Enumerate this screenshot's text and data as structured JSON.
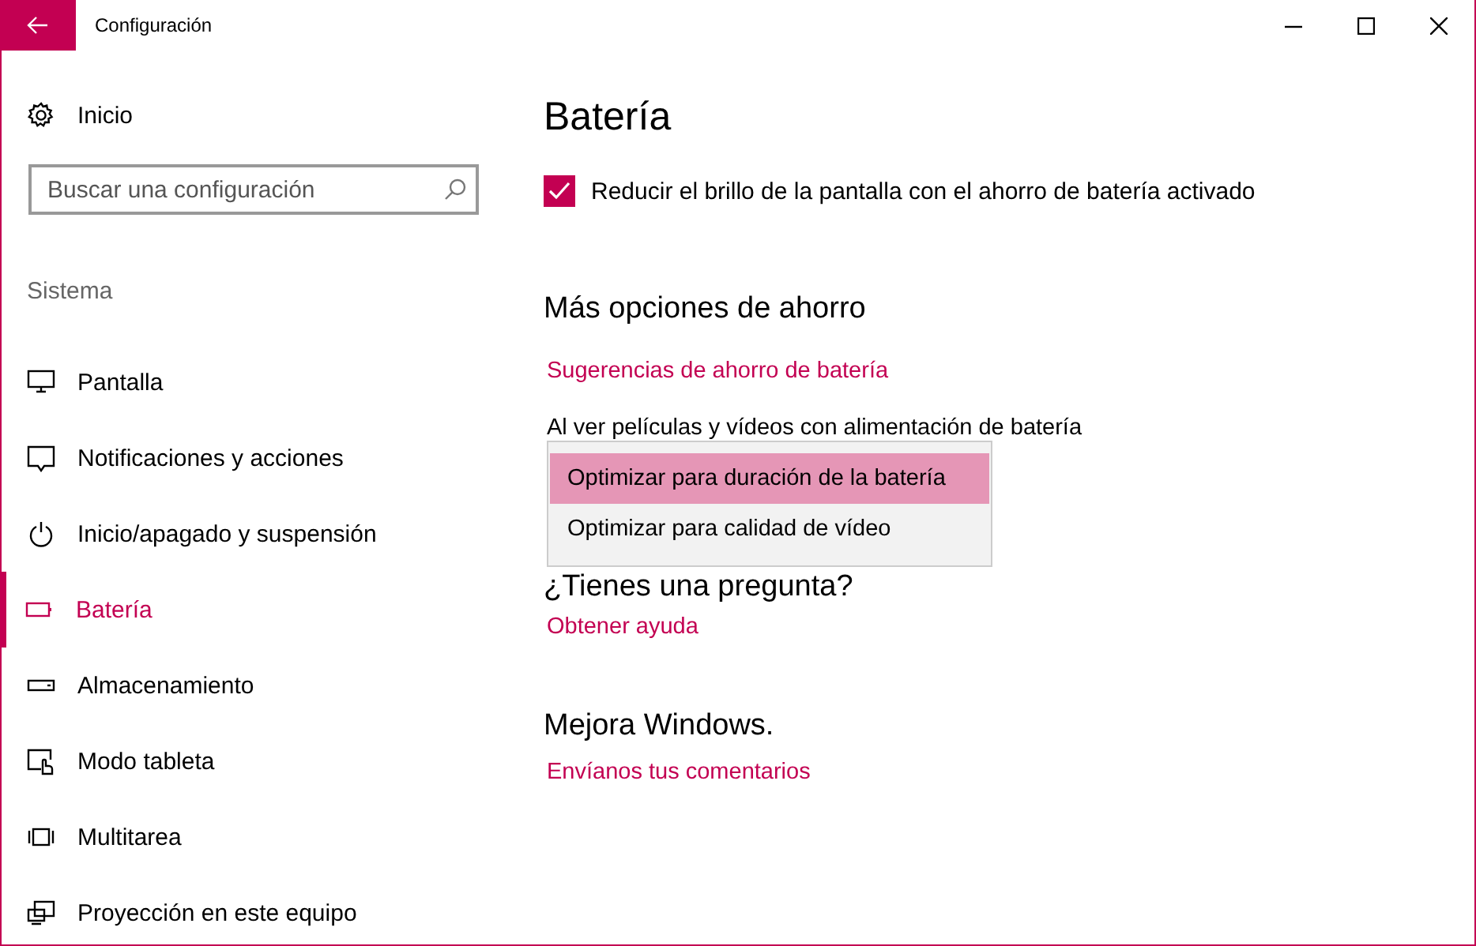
{
  "window": {
    "title": "Configuración"
  },
  "sidebar": {
    "home": "Inicio",
    "search": {
      "placeholder": "Buscar una configuración"
    },
    "section": "Sistema",
    "items": [
      {
        "label": "Pantalla",
        "selected": false
      },
      {
        "label": "Notificaciones y acciones",
        "selected": false
      },
      {
        "label": "Inicio/apagado y suspensión",
        "selected": false
      },
      {
        "label": "Batería",
        "selected": true
      },
      {
        "label": "Almacenamiento",
        "selected": false
      },
      {
        "label": "Modo tableta",
        "selected": false
      },
      {
        "label": "Multitarea",
        "selected": false
      },
      {
        "label": "Proyección en este equipo",
        "selected": false
      }
    ]
  },
  "content": {
    "title": "Batería",
    "checkbox": {
      "label": "Reducir el brillo de la pantalla con el ahorro de batería activado",
      "checked": true
    },
    "more_options": {
      "heading": "Más opciones de ahorro",
      "link": "Sugerencias de ahorro de batería",
      "video_label": "Al ver películas y vídeos con alimentación de batería",
      "dropdown": {
        "options": [
          {
            "label": "Optimizar para duración de la batería",
            "selected": true
          },
          {
            "label": "Optimizar para calidad de vídeo",
            "selected": false
          }
        ]
      }
    },
    "question": {
      "heading": "¿Tienes una pregunta?",
      "link": "Obtener ayuda"
    },
    "improve": {
      "heading": "Mejora Windows.",
      "link": "Envíanos tus comentarios"
    }
  }
}
